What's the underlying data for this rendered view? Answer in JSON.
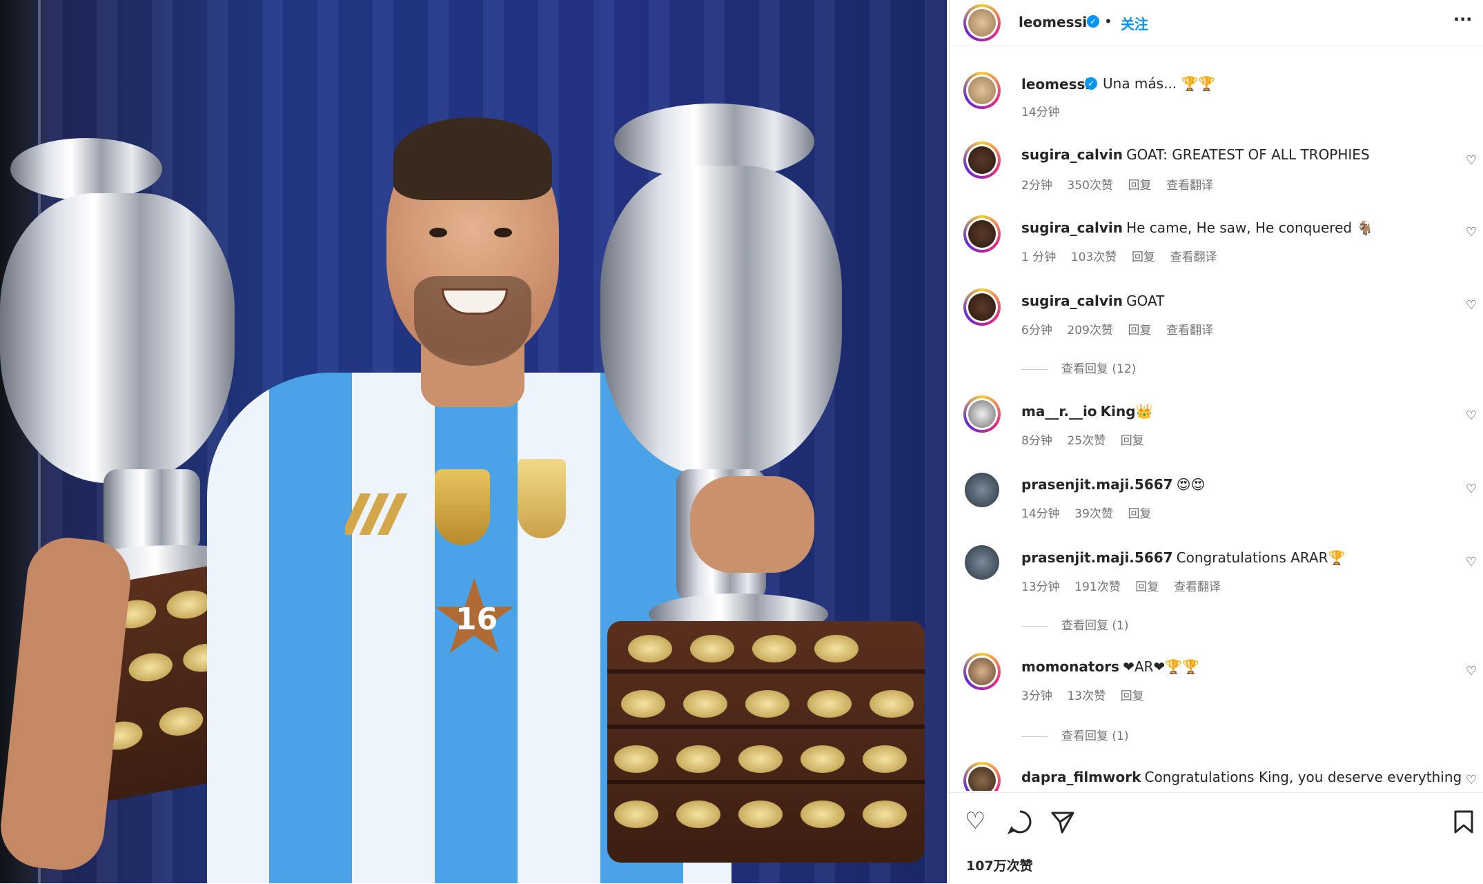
{
  "header": {
    "username": "leomessi",
    "separator": "•",
    "follow_label": "关注",
    "more_label": "···"
  },
  "caption": {
    "username": "leomessi",
    "text": "Una más... 🏆🏆",
    "time": "14分钟"
  },
  "comments": [
    {
      "username": "sugira_calvin",
      "text": "GOAT: GREATEST OF ALL TROPHIES",
      "time": "2分钟",
      "likes": "350次赞",
      "reply": "回复",
      "translate": "查看翻译"
    },
    {
      "username": "sugira_calvin",
      "text": "He came, He saw, He conquered 🐐",
      "time": "1 分钟",
      "likes": "103次赞",
      "reply": "回复",
      "translate": "查看翻译"
    },
    {
      "username": "sugira_calvin",
      "text": "GOAT",
      "time": "6分钟",
      "likes": "209次赞",
      "reply": "回复",
      "translate": "查看翻译",
      "view_replies": "查看回复 (12)"
    },
    {
      "username": "ma__r.__io",
      "text": "King👑",
      "time": "8分钟",
      "likes": "25次赞",
      "reply": "回复"
    },
    {
      "username": "prasenjit.maji.5667",
      "text": "😍😍",
      "time": "14分钟",
      "likes": "39次赞",
      "reply": "回复"
    },
    {
      "username": "prasenjit.maji.5667",
      "text": "Congratulations ARAR🏆",
      "time": "13分钟",
      "likes": "191次赞",
      "reply": "回复",
      "translate": "查看翻译",
      "view_replies": "查看回复 (1)"
    },
    {
      "username": "momonators",
      "text": "❤AR❤🏆🏆",
      "time": "3分钟",
      "likes": "13次赞",
      "reply": "回复",
      "view_replies": "查看回复 (1)"
    },
    {
      "username": "dapra_filmwork",
      "text": "Congratulations King, you deserve everything"
    }
  ],
  "footer": {
    "likes_count": "107万次赞"
  },
  "icons": {
    "like": "heart-icon",
    "comment": "comment-icon",
    "share": "share-icon",
    "save": "bookmark-icon"
  },
  "colors": {
    "verified": "#0095f6",
    "follow": "#0095f6",
    "meta": "#737373"
  }
}
